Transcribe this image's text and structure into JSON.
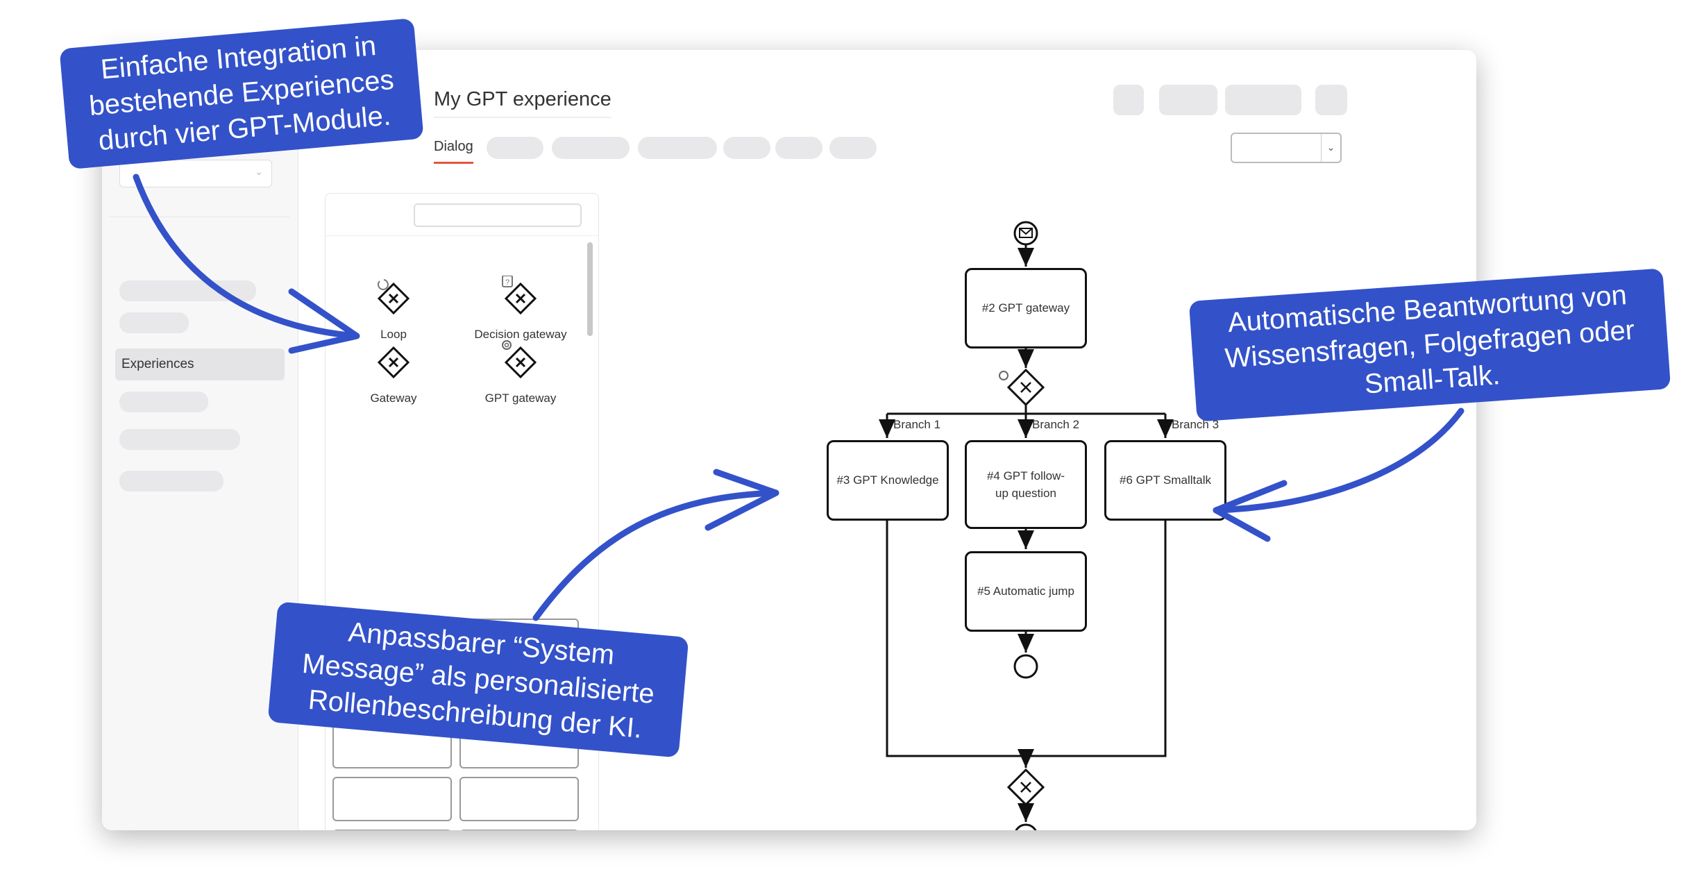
{
  "header": {
    "title": "My GPT experience",
    "active_tab": "Dialog"
  },
  "sidebar": {
    "active_item": "Experiences"
  },
  "palette": {
    "items": [
      {
        "label": "Loop",
        "icon": "loop-gateway-icon"
      },
      {
        "label": "Decision gateway",
        "icon": "decision-gateway-icon"
      },
      {
        "label": "Gateway",
        "icon": "gateway-icon"
      },
      {
        "label": "GPT gateway",
        "icon": "gpt-gateway-icon"
      }
    ]
  },
  "diagram": {
    "nodes": {
      "n2": "#2 GPT gateway",
      "n3": "#3 GPT Knowledge",
      "n4": "#4 GPT follow-up question",
      "n5": "#5 Automatic jump",
      "n6": "#6 GPT Smalltalk"
    },
    "branches": [
      "Branch 1",
      "Branch 2",
      "Branch 3"
    ]
  },
  "callouts": {
    "c1": "Einfache Integration in bestehende Experiences durch vier GPT-Module.",
    "c2": "Automatische Beantwortung von Wissensfragen, Folgefragen oder Small-Talk.",
    "c3": "Anpassbarer “System Message” als personalisierte Rollenbeschreibung der KI."
  },
  "colors": {
    "callout": "#3352c9",
    "tab_underline": "#e8543c"
  }
}
